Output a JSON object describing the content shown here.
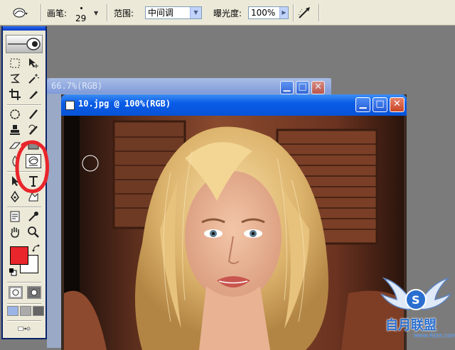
{
  "options_bar": {
    "brush_label": "画笔:",
    "brush_size": "29",
    "range_label": "范围:",
    "range_value": "中间调",
    "exposure_label": "曝光度:",
    "exposure_value": "100%"
  },
  "documents": {
    "back_title": "66.7%(RGB)",
    "front_title": "10.jpg @ 100%(RGB)"
  },
  "watermark": {
    "text": "自月联盟",
    "url": "www.4dzx.com"
  },
  "colors": {
    "foreground": "#e8262b",
    "background": "#ffffff",
    "annotation": "#e8262b"
  }
}
